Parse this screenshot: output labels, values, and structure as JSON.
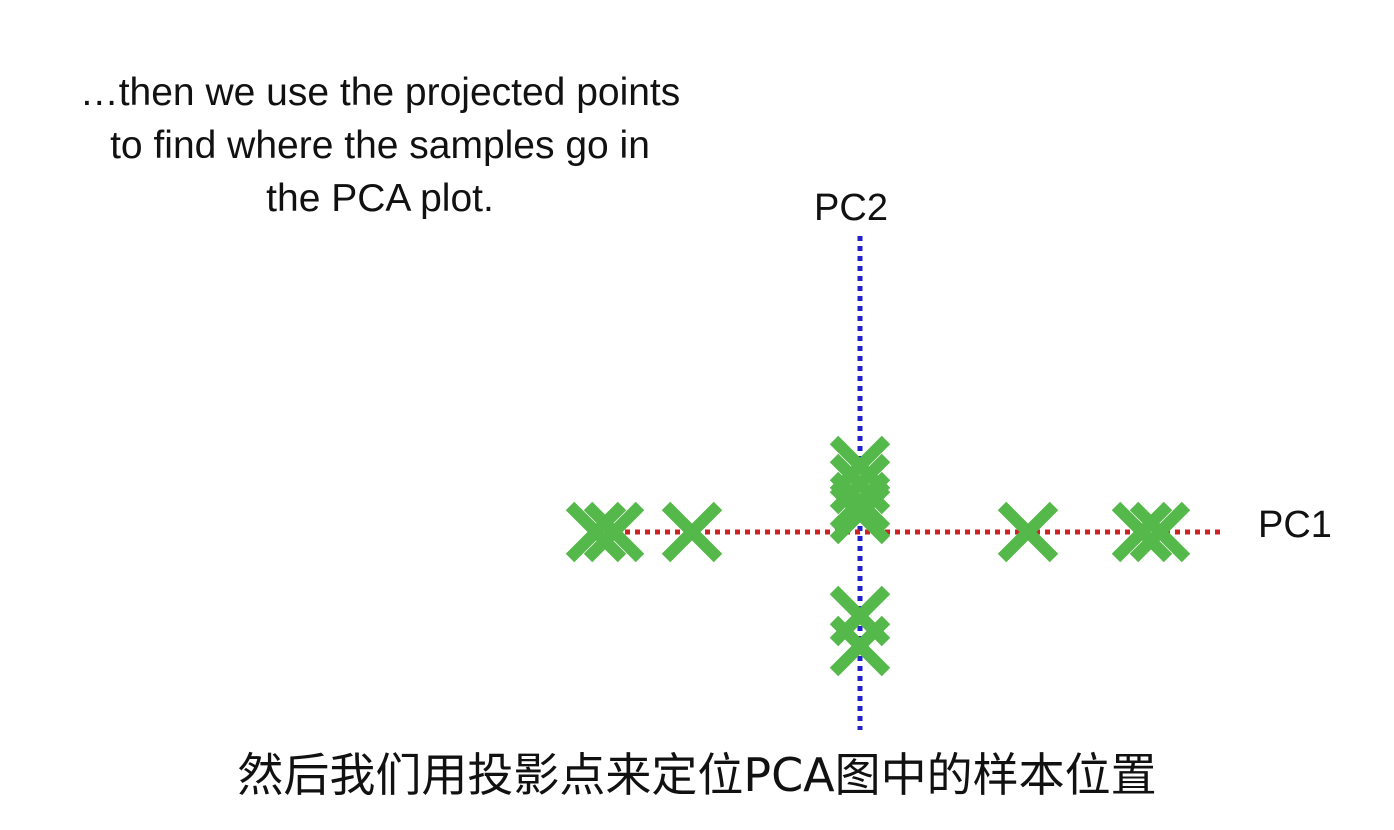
{
  "caption": {
    "line1": "…then we use the projected points",
    "line2": "to find where the samples go in",
    "line3": "the PCA plot."
  },
  "axes": {
    "pc1_label": "PC1",
    "pc2_label": "PC2",
    "pc1_color": "#cc2222",
    "pc2_color": "#2222cc"
  },
  "marker_color": "#55b84a",
  "subtitle": "然后我们用投影点来定位PCA图中的样本位置",
  "pc1_projections": [
    -4.4,
    -4.1,
    -2.8,
    2.8,
    4.7,
    5.0
  ],
  "pc2_projections": [
    1.1,
    0.8,
    0.5,
    0.3,
    -1.4,
    -1.9
  ]
}
